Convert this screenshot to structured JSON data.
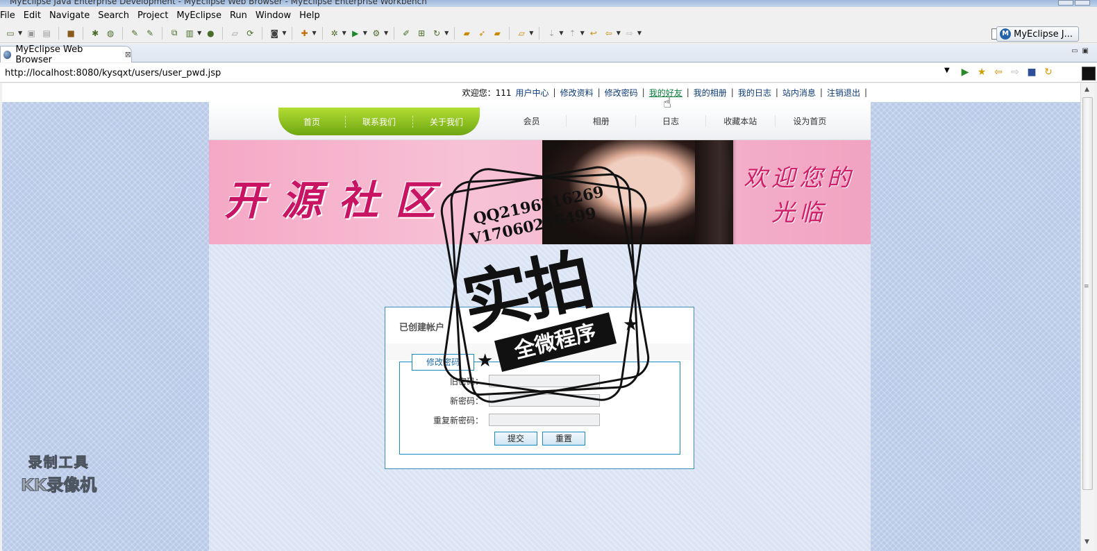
{
  "window": {
    "title": "MyEclipse Java Enterprise Development - MyEclipse Web Browser - MyEclipse Enterprise Workbench"
  },
  "menu": [
    "File",
    "Edit",
    "Navigate",
    "Search",
    "Project",
    "MyEclipse",
    "Run",
    "Window",
    "Help"
  ],
  "perspective": {
    "label": "MyEclipse J..."
  },
  "editor_tab": {
    "label": "MyEclipse Web Browser"
  },
  "browser": {
    "url": "http://localhost:8080/kysqxt/users/user_pwd.jsp"
  },
  "userbar": {
    "welcome": "欢迎您：111",
    "links": [
      "用户中心",
      "修改资料",
      "修改密码",
      "我的好友",
      "我的相册",
      "我的日志",
      "站内消息",
      "注销退出"
    ],
    "hovered": "我的好友"
  },
  "site": {
    "nav_primary": [
      "首页",
      "联系我们",
      "关于我们"
    ],
    "nav_secondary": [
      "会员",
      "相册",
      "日志",
      "收藏本站",
      "设为首页"
    ],
    "banner_title": "开源社区",
    "banner_welcome": "欢迎您的光临"
  },
  "form": {
    "header": "已创建帐户",
    "legend": "修改密码",
    "fields": [
      {
        "label": "旧密码：",
        "value": ""
      },
      {
        "label": "新密码：",
        "value": ""
      },
      {
        "label": "重复新密码：",
        "value": ""
      }
    ],
    "submit_label": "提交",
    "reset_label": "重置"
  },
  "watermark": {
    "qq": "QQ2196316269",
    "vx": "V17060256499",
    "big": "实拍",
    "ribbon": "全微程序",
    "recorder_line1": "录制工具",
    "recorder_line2": "KK录像机"
  },
  "colors": {
    "accent_green": "#8cc21f",
    "link_blue": "#0d3b7a",
    "form_border": "#1c8ac0"
  }
}
